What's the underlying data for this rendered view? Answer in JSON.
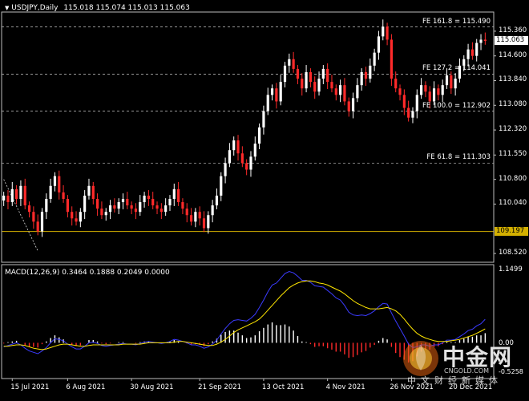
{
  "header": {
    "arrow": "▼",
    "symbol": "USDJPY,Daily",
    "ohlc": "115.018 115.074 115.013 115.063"
  },
  "macd_header": "MACD(12,26,9) 0.3464 0.1888 0.2049 0.0000",
  "badges": {
    "current_price": "115.063",
    "hline_price": "109.197",
    "hline_color": "#d4b000"
  },
  "price_axis": [
    "115.360",
    "114.600",
    "113.840",
    "113.080",
    "112.320",
    "111.550",
    "110.800",
    "110.040",
    "108.520"
  ],
  "macd_axis": {
    "top": "1.1499",
    "zero": "0.00",
    "bottom": "-0.5258"
  },
  "time_axis": [
    "15 Jul 2021",
    "6 Aug 2021",
    "30 Aug 2021",
    "21 Sep 2021",
    "13 Oct 2021",
    "4 Nov 2021",
    "26 Nov 2021",
    "20 Dec 2021"
  ],
  "fib_levels": [
    {
      "label": "FE 161.8 = 115.490",
      "price": 115.49
    },
    {
      "label": "FE 127.2 = 114.041",
      "price": 114.041
    },
    {
      "label": "FE 100.0 = 112.902",
      "price": 112.902
    },
    {
      "label": "FE 61.8 = 111.303",
      "price": 111.303
    }
  ],
  "colors": {
    "background": "#000000",
    "bull": "#ffffff",
    "bear": "#ff2a2a",
    "macd_line": "#3b3bff",
    "signal_line": "#ffe600",
    "grid": "#c8c8c8",
    "hline": "#d4b000"
  },
  "watermark": {
    "brand": "中金网",
    "url": "CNGOLD.COM",
    "tagline": "中文财经新媒体"
  },
  "chart_data": {
    "type": "candlestick",
    "symbol": "USDJPY",
    "timeframe": "Daily",
    "ylim": [
      108.25,
      115.95
    ],
    "horizontal_line": 109.197,
    "closes": [
      110.3,
      110.1,
      110.5,
      110.2,
      110.6,
      110.0,
      109.8,
      109.5,
      109.2,
      109.8,
      110.2,
      110.6,
      110.9,
      110.4,
      110.2,
      109.8,
      109.6,
      109.5,
      109.8,
      110.3,
      110.6,
      110.2,
      109.9,
      109.7,
      109.8,
      110.0,
      109.9,
      110.1,
      110.2,
      110.0,
      109.9,
      109.8,
      110.1,
      110.3,
      110.2,
      110.0,
      109.9,
      109.8,
      110.0,
      110.2,
      110.5,
      110.1,
      109.9,
      109.7,
      109.5,
      109.8,
      109.6,
      109.3,
      109.7,
      110.0,
      110.3,
      110.9,
      111.3,
      111.7,
      112.0,
      111.6,
      111.3,
      111.1,
      111.5,
      111.9,
      112.4,
      112.9,
      113.4,
      113.6,
      113.2,
      113.8,
      114.3,
      114.5,
      114.2,
      113.9,
      113.6,
      114.1,
      113.8,
      113.5,
      113.9,
      114.2,
      113.8,
      113.6,
      113.4,
      113.7,
      113.2,
      112.9,
      113.3,
      113.7,
      114.1,
      113.9,
      114.3,
      114.7,
      115.2,
      115.5,
      115.1,
      113.9,
      113.6,
      113.4,
      113.0,
      112.7,
      112.9,
      113.4,
      113.7,
      113.5,
      113.2,
      113.6,
      113.4,
      113.7,
      114.0,
      113.6,
      113.9,
      114.3,
      114.5,
      114.8,
      114.6,
      115.0,
      115.1,
      115.063
    ],
    "macd_axis_range": [
      -0.5258,
      1.1499
    ],
    "macd_line": [
      -0.06,
      -0.04,
      -0.02,
      0.0,
      -0.03,
      -0.08,
      -0.12,
      -0.14,
      -0.16,
      -0.12,
      -0.07,
      0.0,
      0.06,
      0.05,
      0.03,
      -0.02,
      -0.06,
      -0.09,
      -0.09,
      -0.05,
      0.0,
      0.01,
      -0.01,
      -0.04,
      -0.05,
      -0.04,
      -0.03,
      -0.02,
      -0.01,
      -0.02,
      -0.02,
      -0.03,
      -0.01,
      0.01,
      0.02,
      0.01,
      0.0,
      -0.01,
      0.0,
      0.02,
      0.05,
      0.04,
      0.02,
      0.0,
      -0.03,
      -0.03,
      -0.05,
      -0.08,
      -0.06,
      -0.02,
      0.04,
      0.13,
      0.21,
      0.28,
      0.33,
      0.34,
      0.33,
      0.32,
      0.36,
      0.42,
      0.52,
      0.63,
      0.75,
      0.85,
      0.88,
      0.95,
      1.02,
      1.05,
      1.03,
      0.98,
      0.92,
      0.92,
      0.89,
      0.84,
      0.83,
      0.82,
      0.77,
      0.72,
      0.66,
      0.63,
      0.55,
      0.45,
      0.41,
      0.4,
      0.41,
      0.4,
      0.43,
      0.47,
      0.53,
      0.58,
      0.57,
      0.44,
      0.32,
      0.21,
      0.1,
      -0.02,
      -0.07,
      -0.06,
      -0.03,
      -0.03,
      -0.05,
      -0.03,
      -0.03,
      0.0,
      0.04,
      0.04,
      0.05,
      0.09,
      0.13,
      0.18,
      0.2,
      0.25,
      0.28,
      0.3464
    ],
    "signal_line": [
      -0.05,
      -0.05,
      -0.04,
      -0.03,
      -0.03,
      -0.04,
      -0.06,
      -0.08,
      -0.09,
      -0.1,
      -0.09,
      -0.07,
      -0.05,
      -0.03,
      -0.02,
      -0.02,
      -0.03,
      -0.04,
      -0.05,
      -0.05,
      -0.04,
      -0.03,
      -0.03,
      -0.03,
      -0.03,
      -0.03,
      -0.03,
      -0.03,
      -0.02,
      -0.02,
      -0.02,
      -0.02,
      -0.02,
      -0.01,
      0.0,
      0.0,
      0.0,
      0.0,
      0.0,
      0.0,
      0.01,
      0.02,
      0.02,
      0.01,
      0.0,
      -0.01,
      -0.02,
      -0.03,
      -0.04,
      -0.04,
      -0.02,
      0.01,
      0.05,
      0.1,
      0.15,
      0.19,
      0.22,
      0.25,
      0.28,
      0.31,
      0.35,
      0.41,
      0.48,
      0.55,
      0.62,
      0.69,
      0.75,
      0.81,
      0.85,
      0.88,
      0.9,
      0.91,
      0.91,
      0.9,
      0.88,
      0.87,
      0.85,
      0.82,
      0.79,
      0.76,
      0.72,
      0.67,
      0.62,
      0.58,
      0.55,
      0.52,
      0.5,
      0.5,
      0.5,
      0.51,
      0.52,
      0.5,
      0.47,
      0.42,
      0.35,
      0.27,
      0.2,
      0.14,
      0.1,
      0.07,
      0.05,
      0.03,
      0.02,
      0.02,
      0.02,
      0.03,
      0.04,
      0.05,
      0.07,
      0.09,
      0.11,
      0.14,
      0.17,
      0.2049
    ]
  }
}
